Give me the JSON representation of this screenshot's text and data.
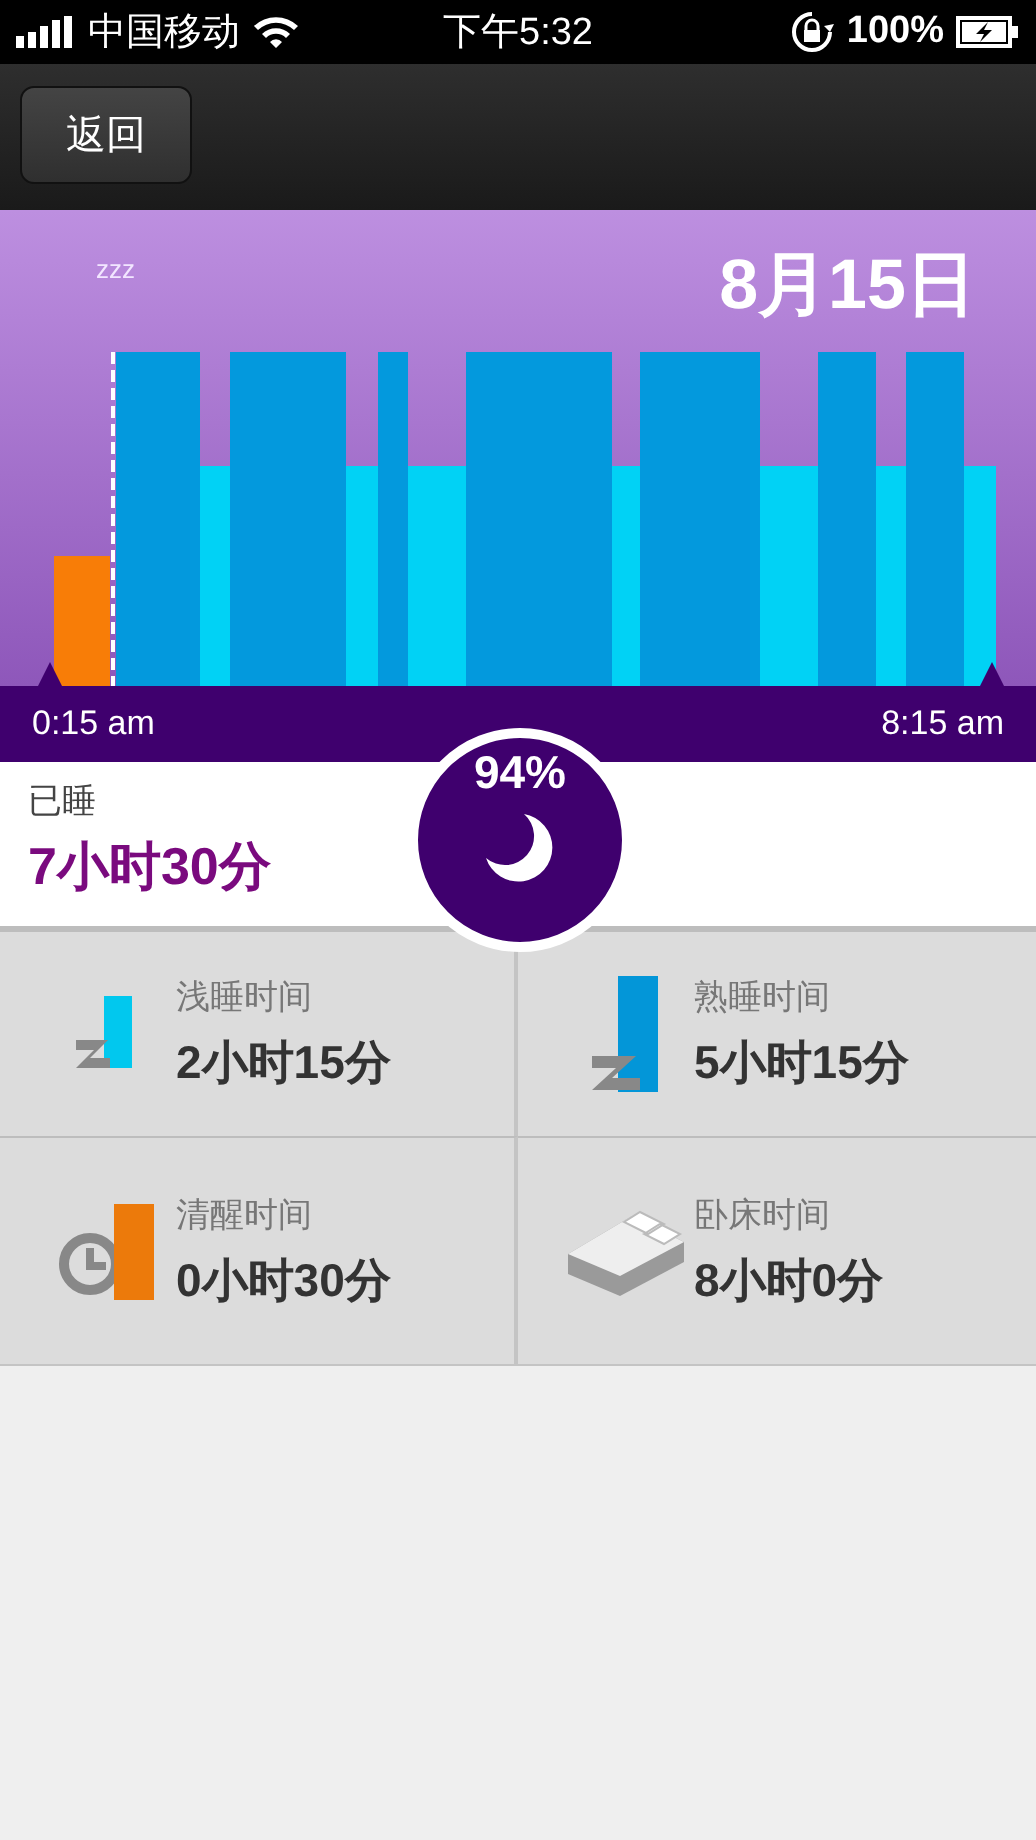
{
  "status_bar": {
    "carrier": "中国移动",
    "time": "下午5:32",
    "battery": "100%"
  },
  "nav": {
    "back_button": "返回"
  },
  "chart": {
    "date": "8月15日",
    "sleep_mark": "zzz",
    "start_time": "0:15 am",
    "end_time": "8:15 am"
  },
  "summary": {
    "label": "已睡",
    "duration": "7小时30分",
    "quality": "94%"
  },
  "stats": [
    {
      "kind": "light",
      "label": "浅睡时间",
      "value": "2小时15分"
    },
    {
      "kind": "deep",
      "label": "熟睡时间",
      "value": "5小时15分"
    },
    {
      "kind": "awake",
      "label": "清醒时间",
      "value": "0小时30分"
    },
    {
      "kind": "bed",
      "label": "卧床时间",
      "value": "8小时0分"
    }
  ]
}
